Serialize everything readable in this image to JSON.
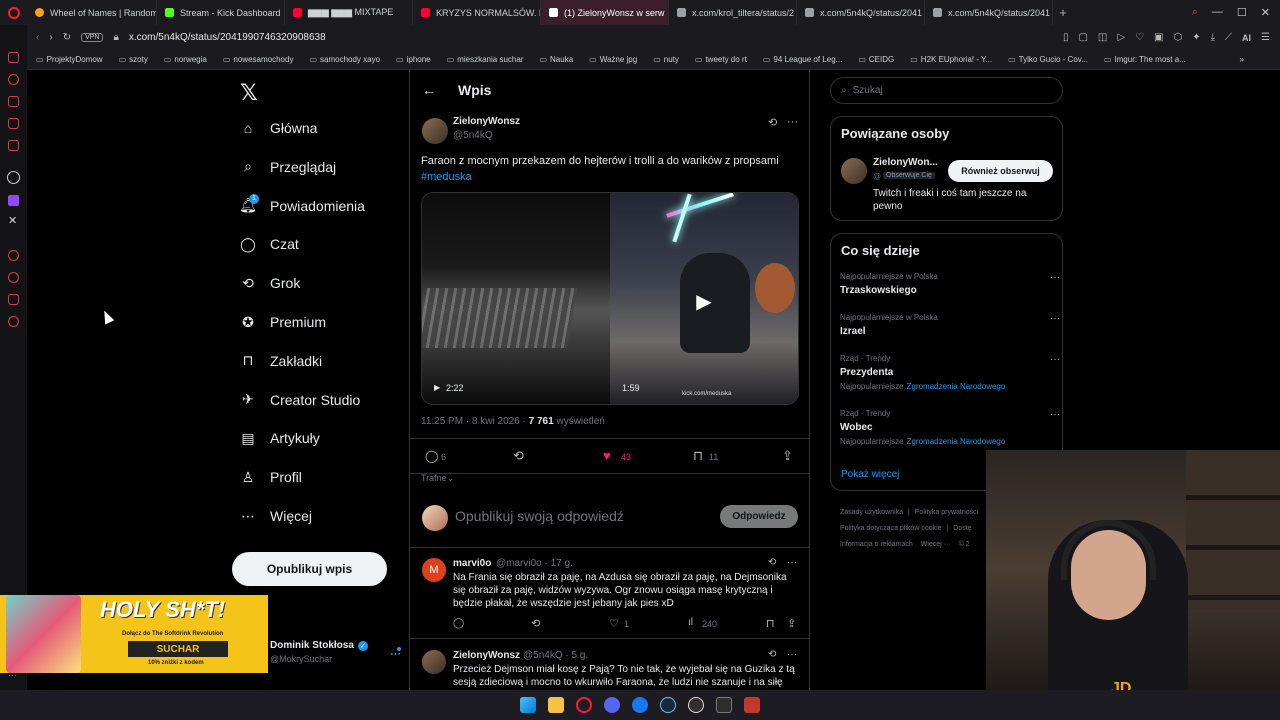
{
  "tabs": [
    {
      "title": "Wheel of Names | Random",
      "color": "#ff9f1c"
    },
    {
      "title": "Stream - Kick Dashboard",
      "color": "#53fc18"
    },
    {
      "title": "▆▆▆ ▆▆▆ MIXTAPE",
      "color": "#ff0033"
    },
    {
      "title": "KRYZYS NORMALSÓW. P",
      "color": "#ff0033"
    },
    {
      "title": "(1) ZielonyWonsz w serw",
      "color": "#ffffff",
      "active": true
    },
    {
      "title": "x.com/krol_tiltera/status/2",
      "color": "#9aa0a6"
    },
    {
      "title": "x.com/5n4kQ/status/2041",
      "color": "#9aa0a6"
    },
    {
      "title": "x.com/5n4kQ/status/2041",
      "color": "#9aa0a6"
    }
  ],
  "browser": {
    "url": "x.com/5n4kQ/status/2041990746320908638",
    "vpn": "VPN",
    "ai": "AI"
  },
  "bookmarks": [
    "ProjektyDomow",
    "szoty",
    "norwegia",
    "nowesamochody",
    "samochody xayo",
    "iphone",
    "mieszkania suchar",
    "Nauka",
    "Ważne jpg",
    "nuty",
    "tweety do rt",
    "94 League of Leg...",
    "CEIDG",
    "H2K EUphoria! - Y...",
    "Tylko Gucio - Cov...",
    "Imgur: The most a..."
  ],
  "nav": {
    "items": [
      "Główna",
      "Przeglądaj",
      "Powiadomienia",
      "Czat",
      "Grok",
      "Premium",
      "Zakładki",
      "Creator Studio",
      "Artykuły",
      "Profil",
      "Więcej"
    ],
    "notif_badge": "1",
    "post_button": "Opublikuj wpis",
    "account_name": "Dominik Stokłosa",
    "account_handle": "@MokrySuchar"
  },
  "header": {
    "title": "Wpis"
  },
  "tweet": {
    "author_name": "ZielonyWonsz",
    "author_handle": "@5n4kQ",
    "text": "Faraon z mocnym przekazem do hejterów i trolli a do warików z propsami",
    "hashtag": "#meduska",
    "video1_duration": "2:22",
    "video2_duration": "1:59",
    "video2_overlay": "kick.com/meduska",
    "time": "11:25 PM · 8 kwi 2026 · ",
    "views": "7 761",
    "views_label": " wyświetleń",
    "replies": "6",
    "likes": "43",
    "bookmarks": "11",
    "sort": "Trafne"
  },
  "reply_box": {
    "placeholder": "Opublikuj swoją odpowiedź",
    "button": "Odpowiedz"
  },
  "replies": [
    {
      "initial": "M",
      "name": "marvi0o",
      "handle": "@marvi0o · 17 g.",
      "text": "Na Frania się obraził za paję, na Azdusa się obraził za paję, na Dejmsonika się obraził za paję, widzów wyzywa. Ogr znowu osiąga masę krytyczną i będzie płakał, że wszędzie jest jebany jak pies xD",
      "replies": "",
      "likes": "1",
      "views": "240"
    },
    {
      "name": "ZielonyWonsz",
      "handle": "@5n4kQ · 5 g.",
      "text": "Przecież Dejmson miał kosę z Pają? To nie tak, że wyjebał się na Guzika z tą sesją zdieciową i mocno to wkurwiło Faraona, że ludzi nie szanuje i na siłę"
    }
  ],
  "search": {
    "placeholder": "Szukaj"
  },
  "related": {
    "title": "Powiązane osoby",
    "name": "ZielonyWon...",
    "handle": "@",
    "follows_you": "Obserwuje Cię",
    "follow_button": "Również obserwuj",
    "bio": "Twitch i freaki i coś tam jeszcze na pewno"
  },
  "trends": {
    "title": "Co się dzieje",
    "items": [
      {
        "context": "Najpopularniejsze w Polska",
        "name": "Trzaskowskiego",
        "sub": ""
      },
      {
        "context": "Najpopularniejsze w Polska",
        "name": "Izrael",
        "sub": ""
      },
      {
        "context": "Rząd · Trendy",
        "name": "Prezydenta",
        "sub": "Najpopularniejsze",
        "sublink": "Zgromadzenia Narodowego"
      },
      {
        "context": "Rząd · Trendy",
        "name": "Wobec",
        "sub": "Najpopularniejsze",
        "sublink": "Zgromadzenia Narodowego"
      }
    ],
    "show_more": "Pokaż więcej"
  },
  "footer": {
    "items": [
      "Zasady użytkownika",
      "Polityka prywatności",
      "Polityka dotycząca plików cookie",
      "Dostę",
      "Informacja o reklamach",
      "Więcej ···",
      "© 2"
    ],
    "separators": [
      "|",
      "|"
    ]
  },
  "ad": {
    "headline": "HOLY SH*T!",
    "line": "Dołącz do The Softdrink Revolution",
    "code": "SUCHAR",
    "discount": "10% zniżki z kodem"
  },
  "colors": {
    "accent": "#1d9bf0",
    "like": "#f91880",
    "bg": "#000000",
    "border": "#2f3336"
  }
}
